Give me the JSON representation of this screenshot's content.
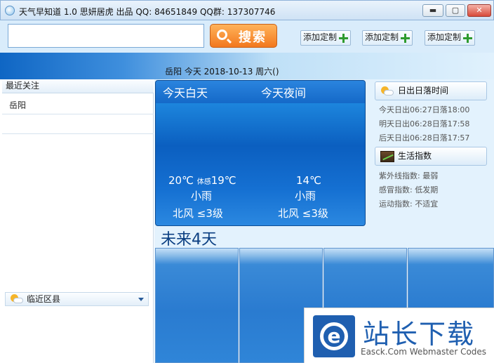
{
  "window": {
    "title": "天气早知道 1.0   思妍居虎 出品 QQ: 84651849 QQ群: 137307746",
    "minimize": "▬",
    "maximize": "▢",
    "close": "✕"
  },
  "toolbar": {
    "search_value": "",
    "search_label": "搜索",
    "add_buttons": [
      "添加定制",
      "添加定制",
      "添加定制"
    ]
  },
  "location_bar": {
    "text": "岳阳  今天  2018-10-13  周六()"
  },
  "sidebar": {
    "recent_header": "最近关注",
    "favorites": [
      "岳阳"
    ],
    "nearby_label": "临近区县"
  },
  "today": {
    "day_label": "今天白天",
    "night_label": "今天夜间",
    "day_temp": "20℃",
    "feel_label": "体感",
    "feel_temp": "19℃",
    "day_cond": "小雨",
    "day_wind": "北风  ≤3级",
    "night_temp": "14℃",
    "night_cond": "小雨",
    "night_wind": "北风  ≤3级"
  },
  "sun": {
    "title": "日出日落时间",
    "lines": [
      "今天日出06:27日落18:00",
      "明天日出06:28日落17:58",
      "后天日出06:28日落17:57"
    ]
  },
  "life": {
    "title": "生活指数",
    "lines": [
      "紫外线指数: 最弱",
      "感冒指数: 低发期",
      "运动指数: 不适宜"
    ]
  },
  "future": {
    "title": "未来4天"
  },
  "watermark": {
    "cn": "站长下载",
    "en": "Easck.Com Webmaster Codes",
    "logo_letter": "e"
  },
  "colors": {
    "accent": "#1f6fcf",
    "search_orange": "#f2781e",
    "title_blue": "#0b3f82"
  }
}
